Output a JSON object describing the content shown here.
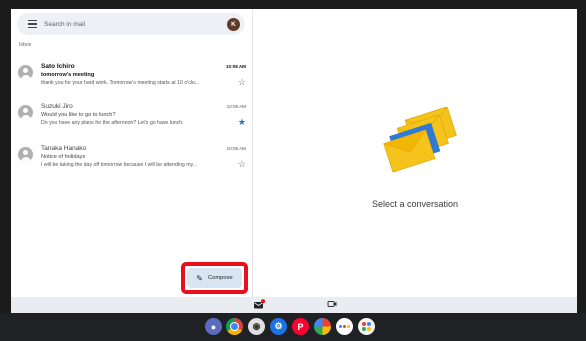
{
  "search": {
    "placeholder": "Search in mail",
    "avatar_letter": "K"
  },
  "inbox_label": "Inbox",
  "emails": [
    {
      "sender": "Sato Ichiro",
      "time": "10:08 AM",
      "subject": "tomorrow's meeting",
      "snippet": "thank you for your hard work. Tomorrow's meeting starts at 10 o'clo...",
      "unread": true,
      "starred": false
    },
    {
      "sender": "Suzuki Jiro",
      "time": "10:08 AM",
      "subject": "Would you like to go to lunch?",
      "snippet": "Do you have any plans for the afternoon? Let's go have lunch.",
      "unread": false,
      "starred": true
    },
    {
      "sender": "Tanaka Hanako",
      "time": "10:08 AM",
      "subject": "Notice of holidays",
      "snippet": "I will be taking the day off tomorrow because I will be attending my...",
      "unread": false,
      "starred": false
    }
  ],
  "compose_label": "Compose",
  "empty_state": "Select a conversation",
  "bottom_nav": {
    "mail_badge": true
  },
  "dock_apps": [
    "launcher-icon",
    "chrome-icon",
    "camera-icon",
    "settings-icon",
    "paypay-icon",
    "photos-icon",
    "assistant-icon",
    "play-games-icon"
  ],
  "colors": {
    "highlight": "#e8101d",
    "star_active": "#1f74c5",
    "compose_bg": "#d8e6f3"
  }
}
